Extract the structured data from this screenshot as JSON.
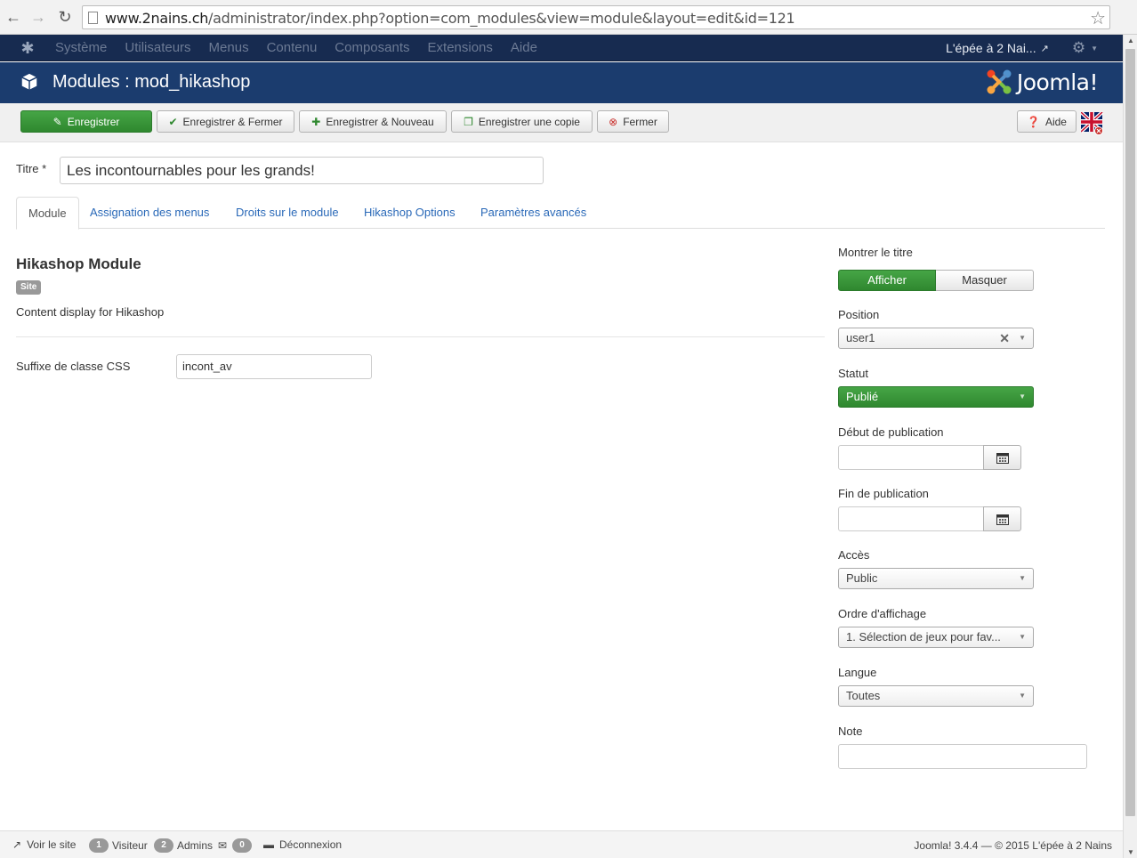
{
  "browser": {
    "url_host": "www.2nains.ch",
    "url_path": "/administrator/index.php?option=com_modules&view=module&layout=edit&id=121"
  },
  "topnav": {
    "items": [
      "Système",
      "Utilisateurs",
      "Menus",
      "Contenu",
      "Composants",
      "Extensions",
      "Aide"
    ],
    "site_name": "L'épée à 2 Nai..."
  },
  "header": {
    "title": "Modules : mod_hikashop",
    "logo_text": "Joomla!"
  },
  "toolbar": {
    "save": "Enregistrer",
    "save_close": "Enregistrer & Fermer",
    "save_new": "Enregistrer & Nouveau",
    "save_copy": "Enregistrer une copie",
    "close": "Fermer",
    "help": "Aide"
  },
  "form": {
    "title_label": "Titre *",
    "title_value": "Les incontournables pour les grands!"
  },
  "tabs": [
    "Module",
    "Assignation des menus",
    "Droits sur le module",
    "Hikashop Options",
    "Paramètres avancés"
  ],
  "module": {
    "heading": "Hikashop Module",
    "badge": "Site",
    "description": "Content display for Hikashop",
    "css_label": "Suffixe de classe CSS",
    "css_value": "incont_av"
  },
  "sidebar": {
    "show_title_label": "Montrer le titre",
    "show_on": "Afficher",
    "show_off": "Masquer",
    "position_label": "Position",
    "position_value": "user1",
    "status_label": "Statut",
    "status_value": "Publié",
    "publish_up_label": "Début de publication",
    "publish_down_label": "Fin de publication",
    "access_label": "Accès",
    "access_value": "Public",
    "ordering_label": "Ordre d'affichage",
    "ordering_value": "1. Sélection de jeux pour fav...",
    "language_label": "Langue",
    "language_value": "Toutes",
    "note_label": "Note"
  },
  "statusbar": {
    "view_site": "Voir le site",
    "visitors_count": "1",
    "visitors_label": "Visiteur",
    "admins_count": "2",
    "admins_label": "Admins",
    "messages_count": "0",
    "logout": "Déconnexion",
    "footer": "Joomla! 3.4.4 — © 2015 L'épée à 2 Nains"
  },
  "colors": {
    "topnav_bg": "#172b50",
    "header_bg": "#1b3c6e",
    "success_green": "#2f882f",
    "link_blue": "#2a69b8"
  }
}
